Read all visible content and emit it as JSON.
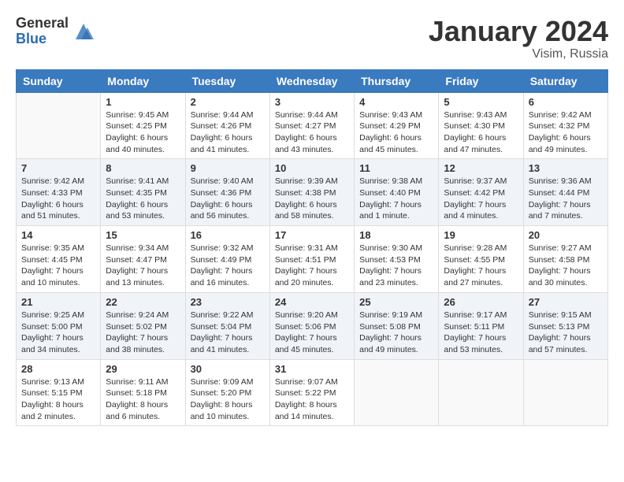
{
  "header": {
    "logo_general": "General",
    "logo_blue": "Blue",
    "month_title": "January 2024",
    "location": "Visim, Russia"
  },
  "weekdays": [
    "Sunday",
    "Monday",
    "Tuesday",
    "Wednesday",
    "Thursday",
    "Friday",
    "Saturday"
  ],
  "weeks": [
    [
      {
        "day": "",
        "info": ""
      },
      {
        "day": "1",
        "info": "Sunrise: 9:45 AM\nSunset: 4:25 PM\nDaylight: 6 hours\nand 40 minutes."
      },
      {
        "day": "2",
        "info": "Sunrise: 9:44 AM\nSunset: 4:26 PM\nDaylight: 6 hours\nand 41 minutes."
      },
      {
        "day": "3",
        "info": "Sunrise: 9:44 AM\nSunset: 4:27 PM\nDaylight: 6 hours\nand 43 minutes."
      },
      {
        "day": "4",
        "info": "Sunrise: 9:43 AM\nSunset: 4:29 PM\nDaylight: 6 hours\nand 45 minutes."
      },
      {
        "day": "5",
        "info": "Sunrise: 9:43 AM\nSunset: 4:30 PM\nDaylight: 6 hours\nand 47 minutes."
      },
      {
        "day": "6",
        "info": "Sunrise: 9:42 AM\nSunset: 4:32 PM\nDaylight: 6 hours\nand 49 minutes."
      }
    ],
    [
      {
        "day": "7",
        "info": "Sunrise: 9:42 AM\nSunset: 4:33 PM\nDaylight: 6 hours\nand 51 minutes."
      },
      {
        "day": "8",
        "info": "Sunrise: 9:41 AM\nSunset: 4:35 PM\nDaylight: 6 hours\nand 53 minutes."
      },
      {
        "day": "9",
        "info": "Sunrise: 9:40 AM\nSunset: 4:36 PM\nDaylight: 6 hours\nand 56 minutes."
      },
      {
        "day": "10",
        "info": "Sunrise: 9:39 AM\nSunset: 4:38 PM\nDaylight: 6 hours\nand 58 minutes."
      },
      {
        "day": "11",
        "info": "Sunrise: 9:38 AM\nSunset: 4:40 PM\nDaylight: 7 hours\nand 1 minute."
      },
      {
        "day": "12",
        "info": "Sunrise: 9:37 AM\nSunset: 4:42 PM\nDaylight: 7 hours\nand 4 minutes."
      },
      {
        "day": "13",
        "info": "Sunrise: 9:36 AM\nSunset: 4:44 PM\nDaylight: 7 hours\nand 7 minutes."
      }
    ],
    [
      {
        "day": "14",
        "info": "Sunrise: 9:35 AM\nSunset: 4:45 PM\nDaylight: 7 hours\nand 10 minutes."
      },
      {
        "day": "15",
        "info": "Sunrise: 9:34 AM\nSunset: 4:47 PM\nDaylight: 7 hours\nand 13 minutes."
      },
      {
        "day": "16",
        "info": "Sunrise: 9:32 AM\nSunset: 4:49 PM\nDaylight: 7 hours\nand 16 minutes."
      },
      {
        "day": "17",
        "info": "Sunrise: 9:31 AM\nSunset: 4:51 PM\nDaylight: 7 hours\nand 20 minutes."
      },
      {
        "day": "18",
        "info": "Sunrise: 9:30 AM\nSunset: 4:53 PM\nDaylight: 7 hours\nand 23 minutes."
      },
      {
        "day": "19",
        "info": "Sunrise: 9:28 AM\nSunset: 4:55 PM\nDaylight: 7 hours\nand 27 minutes."
      },
      {
        "day": "20",
        "info": "Sunrise: 9:27 AM\nSunset: 4:58 PM\nDaylight: 7 hours\nand 30 minutes."
      }
    ],
    [
      {
        "day": "21",
        "info": "Sunrise: 9:25 AM\nSunset: 5:00 PM\nDaylight: 7 hours\nand 34 minutes."
      },
      {
        "day": "22",
        "info": "Sunrise: 9:24 AM\nSunset: 5:02 PM\nDaylight: 7 hours\nand 38 minutes."
      },
      {
        "day": "23",
        "info": "Sunrise: 9:22 AM\nSunset: 5:04 PM\nDaylight: 7 hours\nand 41 minutes."
      },
      {
        "day": "24",
        "info": "Sunrise: 9:20 AM\nSunset: 5:06 PM\nDaylight: 7 hours\nand 45 minutes."
      },
      {
        "day": "25",
        "info": "Sunrise: 9:19 AM\nSunset: 5:08 PM\nDaylight: 7 hours\nand 49 minutes."
      },
      {
        "day": "26",
        "info": "Sunrise: 9:17 AM\nSunset: 5:11 PM\nDaylight: 7 hours\nand 53 minutes."
      },
      {
        "day": "27",
        "info": "Sunrise: 9:15 AM\nSunset: 5:13 PM\nDaylight: 7 hours\nand 57 minutes."
      }
    ],
    [
      {
        "day": "28",
        "info": "Sunrise: 9:13 AM\nSunset: 5:15 PM\nDaylight: 8 hours\nand 2 minutes."
      },
      {
        "day": "29",
        "info": "Sunrise: 9:11 AM\nSunset: 5:18 PM\nDaylight: 8 hours\nand 6 minutes."
      },
      {
        "day": "30",
        "info": "Sunrise: 9:09 AM\nSunset: 5:20 PM\nDaylight: 8 hours\nand 10 minutes."
      },
      {
        "day": "31",
        "info": "Sunrise: 9:07 AM\nSunset: 5:22 PM\nDaylight: 8 hours\nand 14 minutes."
      },
      {
        "day": "",
        "info": ""
      },
      {
        "day": "",
        "info": ""
      },
      {
        "day": "",
        "info": ""
      }
    ]
  ]
}
